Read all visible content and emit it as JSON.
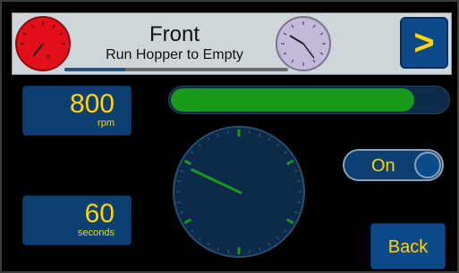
{
  "header": {
    "title": "Front",
    "subtitle": "Run Hopper to Empty",
    "progress_fraction": 0.27,
    "next_label": ">",
    "left_gauge": {
      "color": "#e3101b",
      "label": "0"
    },
    "right_gauge": {
      "color": "#c5b9d9"
    }
  },
  "speed": {
    "value": "800",
    "unit": "rpm"
  },
  "duration": {
    "value": "60",
    "unit": "seconds"
  },
  "progress_bar": {
    "fraction": 0.88,
    "color": "#1a9a1a"
  },
  "dial": {
    "needle_fraction": 0.32,
    "accent_color": "#1a9a1a"
  },
  "toggle": {
    "label": "On",
    "state": "on"
  },
  "back_button": {
    "label": "Back"
  },
  "colors": {
    "accent": "#ffd600",
    "button": "#0d4a8a"
  }
}
